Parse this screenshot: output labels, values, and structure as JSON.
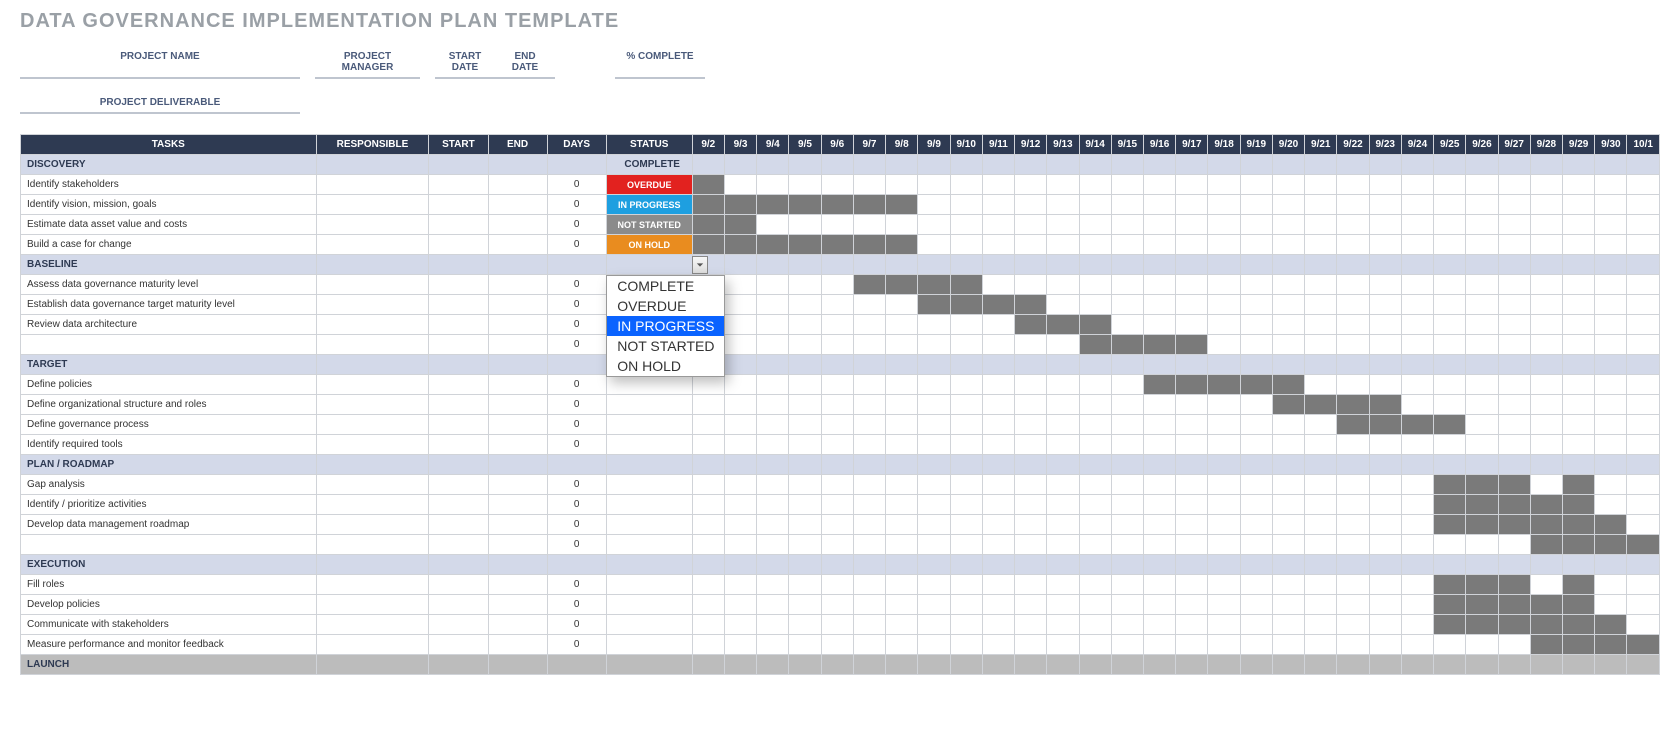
{
  "title": "DATA GOVERNANCE IMPLEMENTATION PLAN TEMPLATE",
  "meta": {
    "project_name": "PROJECT NAME",
    "project_manager": "PROJECT MANAGER",
    "start_date": "START DATE",
    "end_date": "END DATE",
    "pct_complete": "% COMPLETE",
    "project_deliverable": "PROJECT DELIVERABLE"
  },
  "headers": {
    "tasks": "TASKS",
    "responsible": "RESPONSIBLE",
    "start": "START",
    "end": "END",
    "days": "DAYS",
    "status": "STATUS"
  },
  "date_cols": [
    "9/2",
    "9/3",
    "9/4",
    "9/5",
    "9/6",
    "9/7",
    "9/8",
    "9/9",
    "9/10",
    "9/11",
    "9/12",
    "9/13",
    "9/14",
    "9/15",
    "9/16",
    "9/17",
    "9/18",
    "9/19",
    "9/20",
    "9/21",
    "9/22",
    "9/23",
    "9/24",
    "9/25",
    "9/26",
    "9/27",
    "9/28",
    "9/29",
    "9/30",
    "10/1"
  ],
  "status_badges": {
    "complete": "COMPLETE",
    "overdue": "OVERDUE",
    "in_progress": "IN PROGRESS",
    "not_started": "NOT STARTED",
    "on_hold": "ON HOLD"
  },
  "dropdown": {
    "options": [
      "COMPLETE",
      "OVERDUE",
      "IN PROGRESS",
      "NOT STARTED",
      "ON HOLD"
    ],
    "selected_index": 2
  },
  "rows": [
    {
      "type": "phase",
      "label": "DISCOVERY",
      "status_class": "st-complete",
      "status_key": "complete"
    },
    {
      "type": "task",
      "label": "Identify stakeholders",
      "days": "0",
      "status_class": "st-overdue",
      "status_key": "overdue",
      "bar": [
        0,
        0
      ]
    },
    {
      "type": "task",
      "label": "Identify vision, mission, goals",
      "days": "0",
      "status_class": "st-inprog",
      "status_key": "in_progress",
      "bar": [
        0,
        6
      ]
    },
    {
      "type": "task",
      "label": "Estimate data asset value and costs",
      "days": "0",
      "status_class": "st-notstart",
      "status_key": "not_started",
      "bar": [
        0,
        1
      ]
    },
    {
      "type": "task",
      "label": "Build a case for change",
      "days": "0",
      "status_class": "st-onhold",
      "status_key": "on_hold",
      "bar": [
        0,
        6
      ]
    },
    {
      "type": "phase",
      "label": "BASELINE",
      "show_dd": true
    },
    {
      "type": "task",
      "label": "Assess data governance maturity level",
      "days": "0",
      "bar": [
        5,
        8
      ]
    },
    {
      "type": "task",
      "label": "Establish data governance target maturity level",
      "days": "0",
      "bar": [
        7,
        10
      ]
    },
    {
      "type": "task",
      "label": "Review data architecture",
      "days": "0",
      "bar": [
        10,
        12
      ]
    },
    {
      "type": "task",
      "label": "",
      "days": "0",
      "bar": [
        12,
        15
      ]
    },
    {
      "type": "phase",
      "label": "TARGET"
    },
    {
      "type": "task",
      "label": "Define policies",
      "days": "0",
      "bar": [
        14,
        18
      ]
    },
    {
      "type": "task",
      "label": "Define organizational structure and roles",
      "days": "0",
      "bar": [
        18,
        21
      ]
    },
    {
      "type": "task",
      "label": "Define governance process",
      "days": "0",
      "bar": [
        20,
        23
      ]
    },
    {
      "type": "task",
      "label": "Identify required tools",
      "days": "0"
    },
    {
      "type": "phase",
      "label": "PLAN / ROADMAP"
    },
    {
      "type": "task",
      "label": "Gap analysis",
      "days": "0",
      "bar": [
        23,
        25
      ],
      "extra_bar": [
        27,
        27
      ]
    },
    {
      "type": "task",
      "label": "Identify / prioritize activities",
      "days": "0",
      "bar": [
        23,
        27
      ]
    },
    {
      "type": "task",
      "label": "Develop data management roadmap",
      "days": "0",
      "bar": [
        23,
        28
      ]
    },
    {
      "type": "task",
      "label": "",
      "days": "0",
      "bar": [
        26,
        29
      ]
    },
    {
      "type": "phase",
      "label": "EXECUTION"
    },
    {
      "type": "task",
      "label": "Fill roles",
      "days": "0",
      "bar": [
        23,
        25
      ],
      "extra_bar": [
        27,
        27
      ]
    },
    {
      "type": "task",
      "label": "Develop policies",
      "days": "0",
      "bar": [
        23,
        27
      ]
    },
    {
      "type": "task",
      "label": "Communicate with stakeholders",
      "days": "0",
      "bar": [
        23,
        28
      ]
    },
    {
      "type": "task",
      "label": "Measure performance and monitor feedback",
      "days": "0",
      "bar": [
        26,
        29
      ]
    },
    {
      "type": "phase",
      "label": "LAUNCH",
      "gray": true
    }
  ]
}
